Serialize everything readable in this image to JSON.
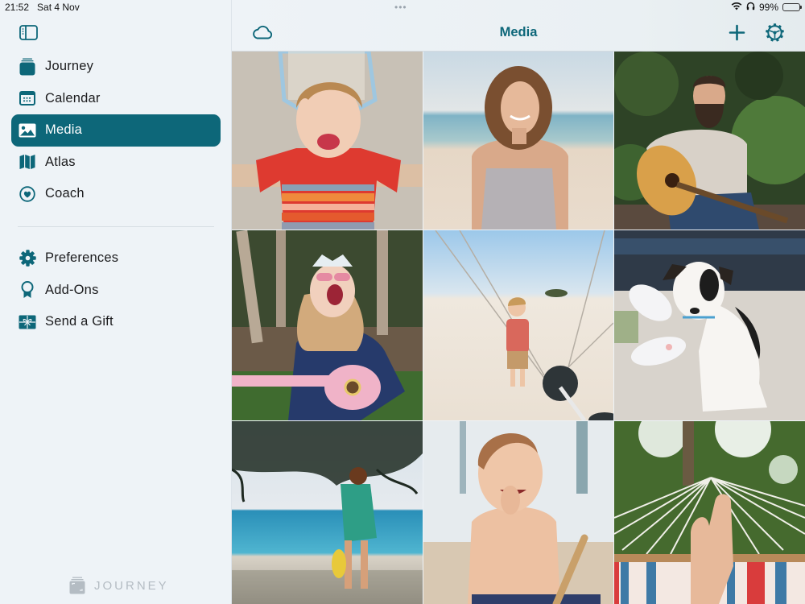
{
  "status_bar": {
    "time": "21:52",
    "date": "Sat 4 Nov",
    "multitask_indicator": "•••",
    "wifi_icon": "wifi-icon",
    "headphones_icon": "headphones-icon",
    "battery_percent": "99%",
    "battery_level": 0.99
  },
  "colors": {
    "accent": "#0d6779",
    "sidebar_bg": "#eef3f7",
    "muted_brand": "#b4bcc3"
  },
  "sidebar": {
    "toggle_icon": "sidebar-toggle-icon",
    "primary_items": [
      {
        "label": "Journey",
        "icon": "journal-stack-icon",
        "active": false
      },
      {
        "label": "Calendar",
        "icon": "calendar-icon",
        "active": false
      },
      {
        "label": "Media",
        "icon": "image-icon",
        "active": true
      },
      {
        "label": "Atlas",
        "icon": "map-icon",
        "active": false
      },
      {
        "label": "Coach",
        "icon": "heart-circle-icon",
        "active": false
      }
    ],
    "secondary_items": [
      {
        "label": "Preferences",
        "icon": "gear-icon"
      },
      {
        "label": "Add-Ons",
        "icon": "ribbon-award-icon"
      },
      {
        "label": "Send a Gift",
        "icon": "gift-icon"
      }
    ],
    "brand_label": "JOURNEY"
  },
  "header": {
    "title": "Media",
    "left_button_icon": "cloud-icon",
    "right_buttons": [
      {
        "icon": "plus-icon",
        "label": "Add"
      },
      {
        "icon": "settings-wheel-icon",
        "label": "Settings"
      }
    ]
  },
  "media": {
    "photos": [
      {
        "alt": "Boy laughing with eyes closed lying on chalk-drawn pavement, red striped shirt"
      },
      {
        "alt": "Smiling woman with curly hair on a beach"
      },
      {
        "alt": "Bearded man with acoustic guitar in front of green foliage"
      },
      {
        "alt": "Girl in tiara and pink sunglasses singing with a pink ukulele"
      },
      {
        "alt": "Toddler in red shirt standing on sand near ropes and a black ball"
      },
      {
        "alt": "Black and white puppy holding a white toy"
      },
      {
        "alt": "Woman in green dress with yellow bag facing the sea under trees"
      },
      {
        "alt": "Shirtless toddler laughing, holding a wooden spoon"
      },
      {
        "alt": "Bare feet resting on a striped hammock among trees"
      }
    ]
  }
}
